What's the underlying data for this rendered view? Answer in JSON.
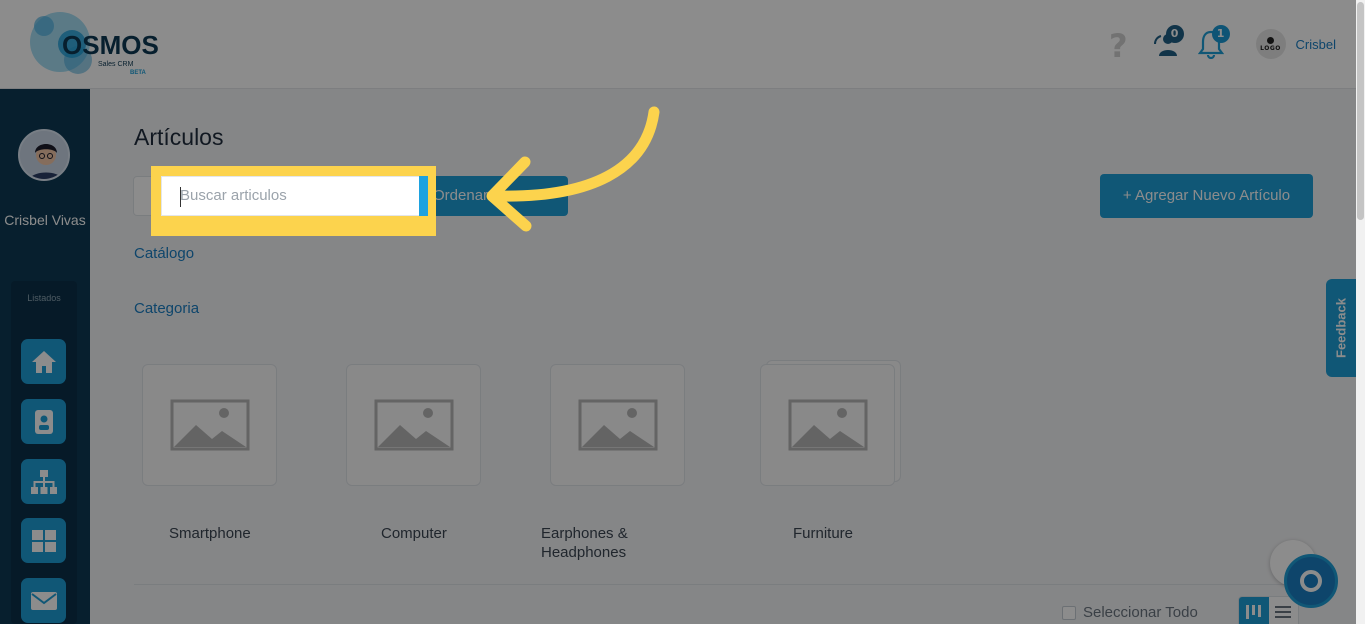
{
  "header": {
    "logo_text": "OSMOS",
    "logo_sub": "Sales CRM",
    "logo_badge": "BETA",
    "help_icon": "question-icon",
    "contacts_badge": "0",
    "notifications_badge": "1",
    "org_logo_text": "LOGO",
    "user_name": "Crisbel"
  },
  "sidebar": {
    "user_name": "Crisbel Vivas",
    "section_label": "Listados",
    "items": [
      {
        "icon": "home-icon"
      },
      {
        "icon": "contact-card-icon"
      },
      {
        "icon": "org-chart-icon"
      },
      {
        "icon": "grid-icon"
      },
      {
        "icon": "mail-icon"
      }
    ]
  },
  "main": {
    "title": "Artículos",
    "search_placeholder": "Buscar articulos",
    "order_button": "Ordenar",
    "add_button": "+ Agregar Nuevo Artículo",
    "catalog_link": "Catálogo",
    "category_link": "Categoria",
    "categories": [
      {
        "label": "Smartphone"
      },
      {
        "label": "Computer"
      },
      {
        "label": "Earphones & Headphones"
      },
      {
        "label": "Furniture"
      }
    ],
    "select_all": "Seleccionar Todo"
  },
  "feedback_label": "Feedback",
  "colors": {
    "brand": "#1e9fd8",
    "sidebar": "#0e3a54",
    "highlight": "#fcd34d"
  }
}
